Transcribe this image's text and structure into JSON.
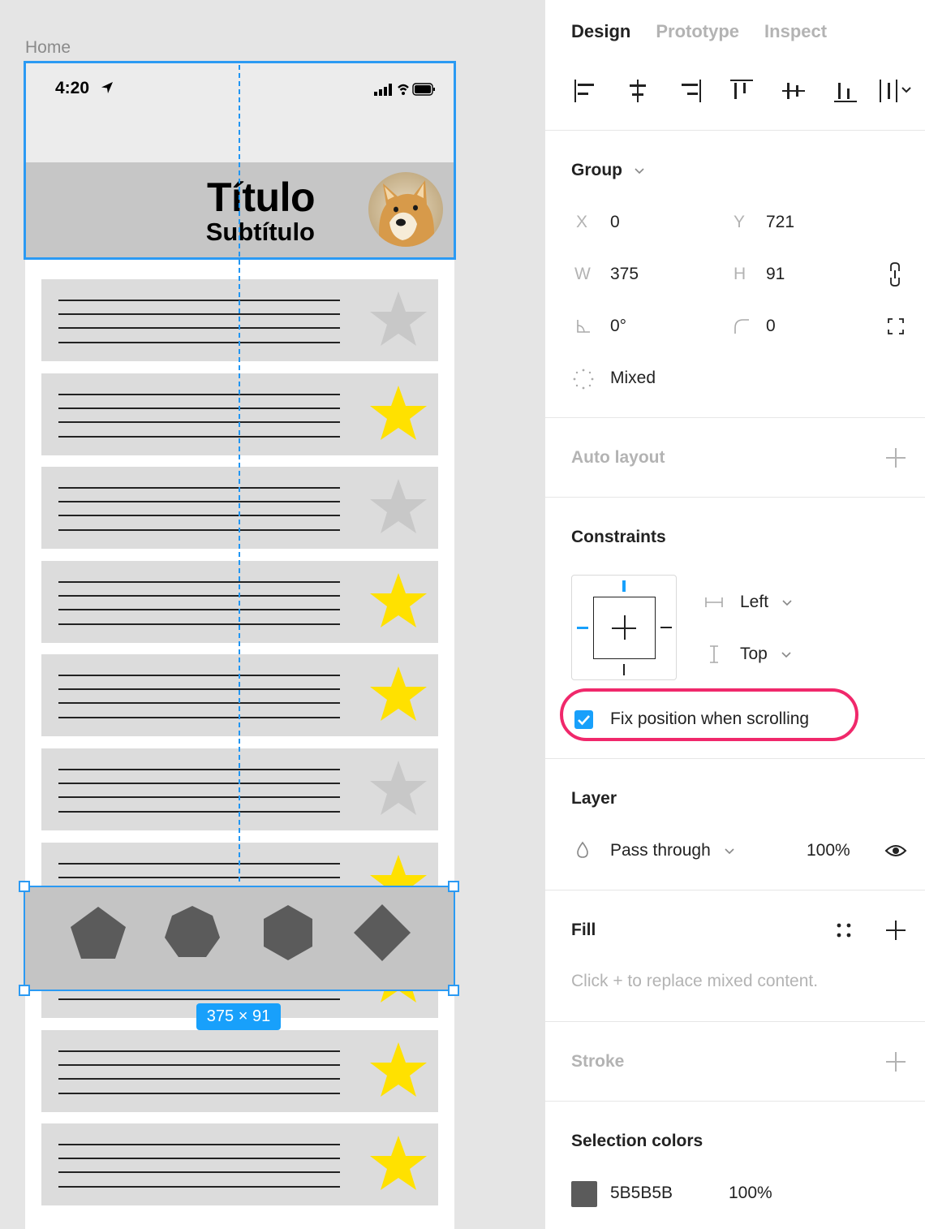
{
  "canvas": {
    "frame_label": "Home",
    "status_time": "4:20",
    "header_title": "Título",
    "header_subtitle": "Subtítulo",
    "dimension_badge": "375 × 91",
    "list_stars": [
      "gray",
      "yellow",
      "gray",
      "yellow",
      "yellow",
      "gray",
      "yellow",
      "yellow",
      "yellow",
      "yellow"
    ],
    "tab_icons": [
      "pentagon-icon",
      "heptagon-icon",
      "hexagon-icon",
      "diamond-icon"
    ],
    "colors": {
      "selection": "#2b9af3",
      "star_on": "#ffe100",
      "star_off": "#c8c8c8",
      "shape": "#5b5b5b"
    }
  },
  "panel": {
    "tabs": [
      "Design",
      "Prototype",
      "Inspect"
    ],
    "active_tab": "Design",
    "group": {
      "title": "Group",
      "x_label": "X",
      "x_value": "0",
      "y_label": "Y",
      "y_value": "721",
      "w_label": "W",
      "w_value": "375",
      "h_label": "H",
      "h_value": "91",
      "rotation": "0°",
      "radius": "0",
      "mixed": "Mixed"
    },
    "auto_layout": "Auto layout",
    "constraints": {
      "title": "Constraints",
      "horizontal": "Left",
      "vertical": "Top",
      "fix_position": "Fix position when scrolling",
      "fix_checked": true
    },
    "layer": {
      "title": "Layer",
      "blend": "Pass through",
      "opacity": "100%"
    },
    "fill": {
      "title": "Fill",
      "hint": "Click + to replace mixed content."
    },
    "stroke": "Stroke",
    "selection_colors": {
      "title": "Selection colors",
      "hex": "5B5B5B",
      "opacity": "100%",
      "color": "#5b5b5b"
    }
  }
}
